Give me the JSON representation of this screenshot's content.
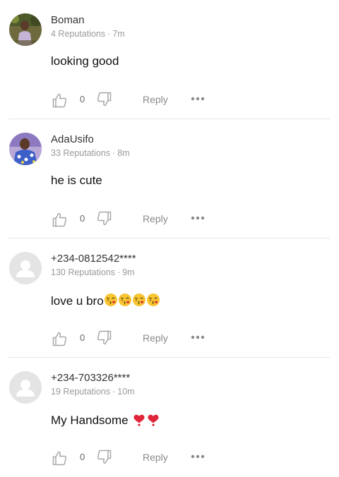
{
  "ui": {
    "reply_label": "Reply",
    "colors": {
      "icon_gray": "#a8a8a8",
      "heart_red": "#e0253a",
      "emoji_yellow": "#f7c531",
      "divider": "#e6e6e6"
    },
    "icons": [
      "thumbs-up-icon",
      "thumbs-down-icon",
      "more-dots-icon",
      "heart-emoji",
      "kiss-emoji",
      "default-avatar-icon"
    ]
  },
  "comments": [
    {
      "username": "Boman",
      "reputation": "4 Reputations",
      "separator": "·",
      "time": "7m",
      "text": "looking good",
      "likes": "0",
      "avatar": "photo"
    },
    {
      "username": "AdaUsifo",
      "reputation": "33 Reputations",
      "separator": "·",
      "time": "8m",
      "text": "he is cute",
      "likes": "0",
      "avatar": "photo"
    },
    {
      "username": "+234-0812542****",
      "reputation": "130 Reputations",
      "separator": "·",
      "time": "9m",
      "text": "love u bro",
      "likes": "0",
      "avatar": "default",
      "emojis": [
        "kiss",
        "kiss",
        "kiss",
        "kiss"
      ]
    },
    {
      "username": "+234-703326****",
      "reputation": "19 Reputations",
      "separator": "·",
      "time": "10m",
      "text": "My Handsome",
      "likes": "0",
      "avatar": "default",
      "emojis": [
        "heart",
        "heart"
      ]
    }
  ]
}
